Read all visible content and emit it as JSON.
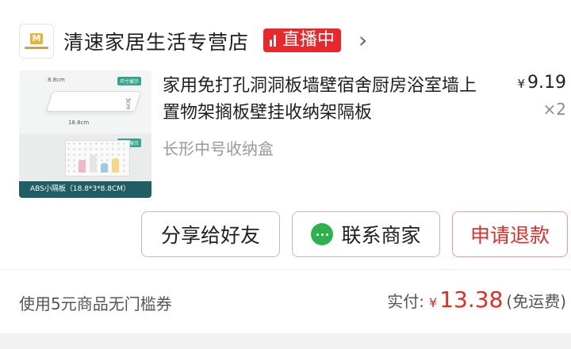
{
  "shop": {
    "name": "清速家居生活专营店",
    "live_label": "直播中"
  },
  "product": {
    "title": "家用免打孔洞洞板墙壁宿舍厨房浴室墙上置物架搁板壁挂收纳架隔板",
    "spec": "长形中号收纳盒",
    "price_currency": "¥",
    "price": "9.19",
    "quantity": "×2",
    "thumbnail": {
      "caption": "ABS小隔板（18.8*3*8.8CM）",
      "tag_size": "尺寸展示",
      "tag_demo": "实拍展示",
      "dim_width": "8.8cm",
      "dim_length": "18.8cm",
      "dim_height": "3cm"
    }
  },
  "actions": {
    "share_label": "分享给好友",
    "contact_label": "联系商家",
    "refund_label": "申请退款"
  },
  "summary": {
    "coupon_text": "使用5元商品无门槛券",
    "paid_label": "实付:",
    "paid_currency": "¥",
    "paid_amount": "13.38",
    "paid_note": "(免运费)"
  },
  "colors": {
    "accent_red": "#e02e24",
    "live_badge": "#e8282b",
    "wechat_green": "#2bb24c"
  }
}
